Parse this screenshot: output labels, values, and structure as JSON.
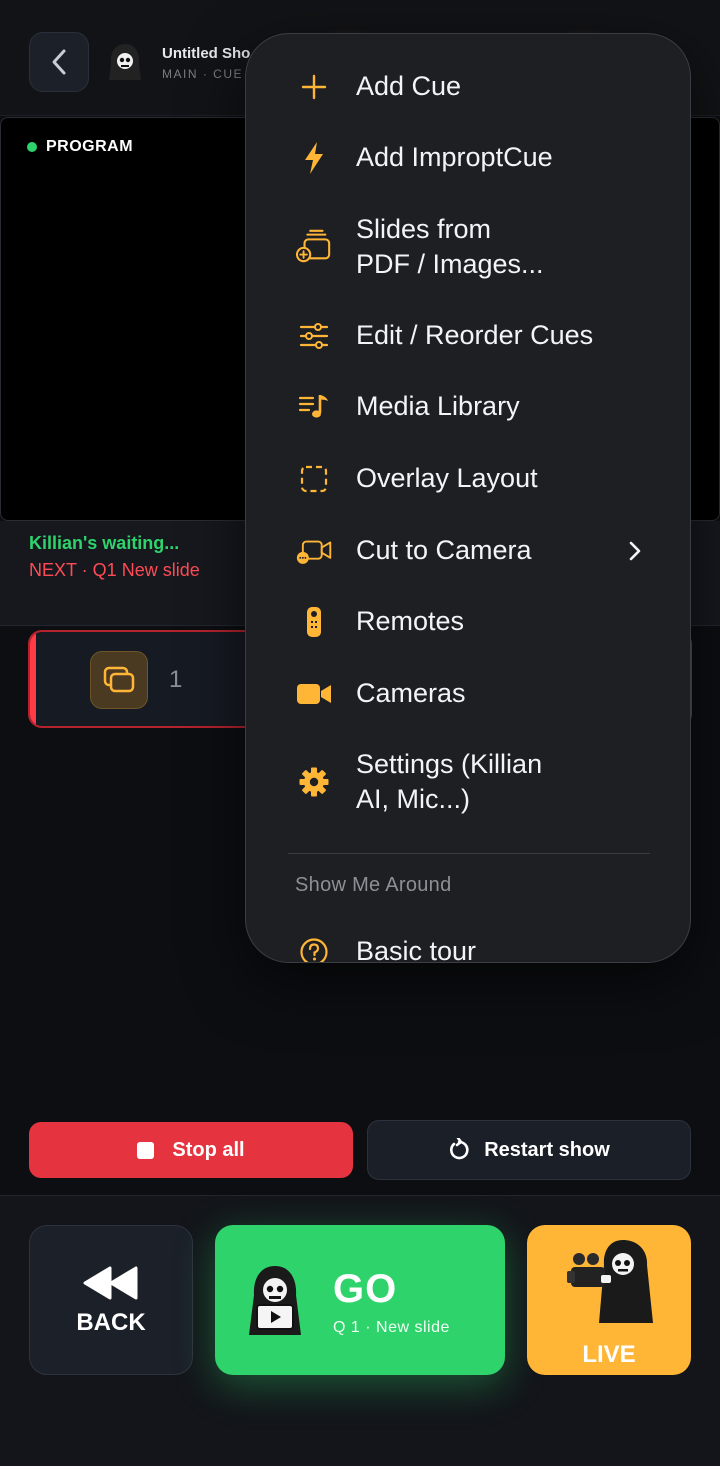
{
  "header": {
    "show_title": "Untitled Sho",
    "show_sub": "MAIN  ·  CUE"
  },
  "program": {
    "label": "PROGRAM"
  },
  "status": {
    "waiting": "Killian's waiting...",
    "next": "NEXT · Q1  New slide"
  },
  "cue_list": [
    {
      "number": "1"
    }
  ],
  "actions": {
    "stop_all": "Stop all",
    "restart": "Restart show"
  },
  "transport": {
    "back": "BACK",
    "go": "GO",
    "go_sub": "Q 1  ·  New slide",
    "live": "LIVE"
  },
  "menu": {
    "items": [
      {
        "label": "Add Cue",
        "icon": "plus-icon"
      },
      {
        "label": "Add ImproptCue",
        "icon": "bolt-icon"
      },
      {
        "label": "Slides from",
        "label2": "PDF / Images...",
        "icon": "slides-add-icon"
      },
      {
        "label": "Edit / Reorder Cues",
        "icon": "sliders-icon"
      },
      {
        "label": "Media Library",
        "icon": "music-list-icon"
      },
      {
        "label": "Overlay Layout",
        "icon": "dashed-square-icon"
      },
      {
        "label": "Cut to Camera",
        "icon": "camera-outline-icon",
        "has_submenu": true
      },
      {
        "label": "Remotes",
        "icon": "remote-icon"
      },
      {
        "label": "Cameras",
        "icon": "video-camera-icon"
      },
      {
        "label": "Settings (Killian",
        "label2": "AI, Mic...)",
        "icon": "gear-icon"
      }
    ],
    "section_title": "Show Me Around",
    "tour_item": {
      "label": "Basic tour",
      "icon": "help-circle-icon"
    }
  },
  "colors": {
    "accent_orange": "#ffb536",
    "go_green": "#2ed36b",
    "stop_red": "#e5343f",
    "next_red": "#ff4b55"
  }
}
